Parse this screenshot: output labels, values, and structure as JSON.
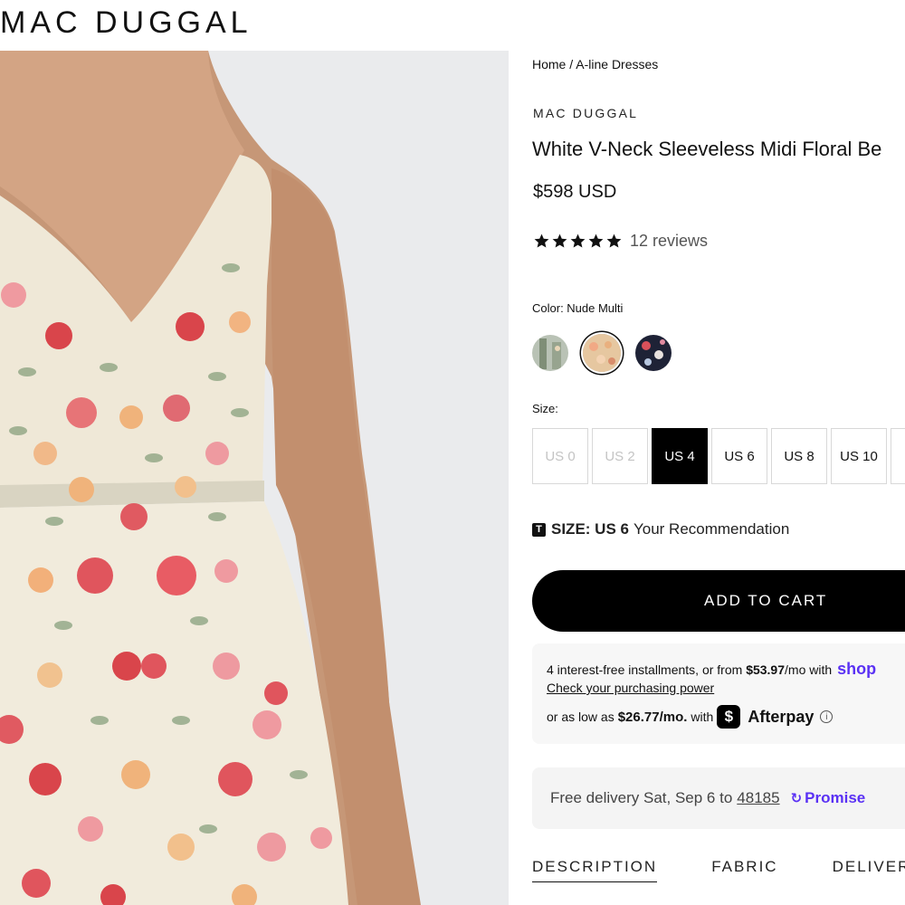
{
  "header": {
    "logo_text": "MAC DUGGAL"
  },
  "hero": {
    "alt_name": "product photo"
  },
  "breadcrumb": {
    "home": "Home",
    "separator": "/",
    "category": "A-line Dresses"
  },
  "product": {
    "brand": "MAC DUGGAL",
    "title": "White V-Neck Sleeveless Midi Floral Be",
    "price": "$598 USD",
    "rating_stars": 5,
    "reviews": "12 reviews"
  },
  "color": {
    "label": "Color: Nude Multi",
    "swatches": [
      {
        "name": "sage"
      },
      {
        "name": "nude-multi",
        "selected": true
      },
      {
        "name": "navy-floral"
      }
    ]
  },
  "size": {
    "label": "Size:",
    "options": [
      {
        "label": "US 0",
        "state": "disabled"
      },
      {
        "label": "US 2",
        "state": "disabled"
      },
      {
        "label": "US 4",
        "state": "active"
      },
      {
        "label": "US 6",
        "state": "normal"
      },
      {
        "label": "US 8",
        "state": "normal"
      },
      {
        "label": "US 10",
        "state": "normal"
      },
      {
        "label": "",
        "state": "normal"
      }
    ]
  },
  "recommendation": {
    "icon": "T",
    "prefix": "SIZE: US 6",
    "text": "Your Recommendation"
  },
  "cart": {
    "add_to_cart": "ADD TO CART"
  },
  "payments": {
    "shop_text_a": "4 interest-free installments, or from ",
    "shop_amount": "$53.97",
    "shop_text_b": "/mo with",
    "shop_brand": "shop",
    "shop_link": "Check your purchasing power",
    "afterpay_text_a": "or as low as",
    "afterpay_amount": "$26.77/mo.",
    "afterpay_text_b": "with",
    "afterpay_brand": "Afterpay",
    "afterpay_icon": "$",
    "info_icon": "i"
  },
  "delivery": {
    "text": "Free delivery Sat, Sep 6 to",
    "zip": "48185",
    "promise_brand": "Promise",
    "promise_icon": "↻"
  },
  "tabs": [
    {
      "label": "DESCRIPTION",
      "active": true
    },
    {
      "label": "FABRIC",
      "active": false
    },
    {
      "label": "DELIVERY &",
      "active": false
    }
  ],
  "colors": {
    "accent": "#000000",
    "shop_purple": "#5a31f4",
    "dress_cream": "#efe8d8",
    "skin": "#c99a78"
  }
}
